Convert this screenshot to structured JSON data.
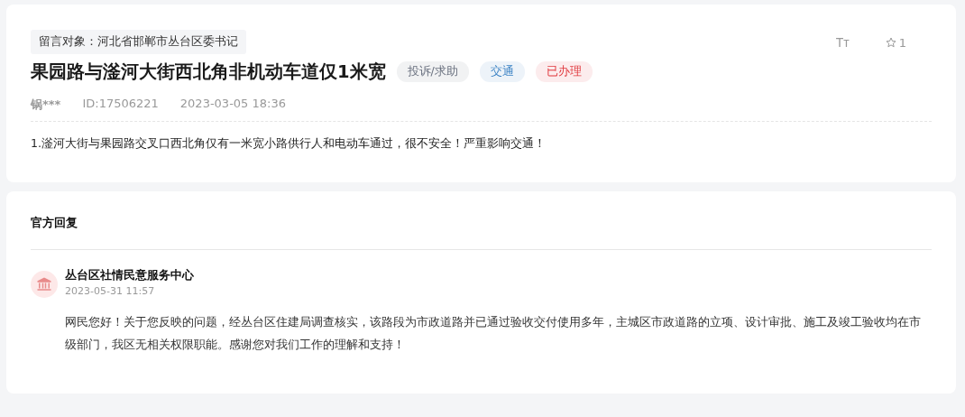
{
  "message": {
    "target": "留言对象：河北省邯郸市丛台区委书记",
    "title": "果园路与滏河大街西北角非机动车道仅1米宽",
    "tags": [
      {
        "label": "投诉/求助",
        "color": "#6b7280"
      },
      {
        "label": "交通",
        "color": "#3b82c4"
      },
      {
        "label": "已办理",
        "color": "#e0393e"
      }
    ],
    "text_size_label": "Tт",
    "star_count": "1",
    "author": "锅***",
    "id": "ID:17506221",
    "time": "2023-03-05 18:36",
    "body": "1.滏河大街与果园路交叉口西北角仅有一米宽小路供行人和电动车通过，很不安全！严重影响交通！"
  },
  "reply_section": {
    "heading": "官方回复",
    "replies": [
      {
        "org": "丛台区社情民意服务中心",
        "time": "2023-05-31 11:57",
        "body": "网民您好！关于您反映的问题，经丛台区住建局调查核实，该路段为市政道路并已通过验收交付使用多年，主城区市政道路的立项、设计审批、施工及竣工验收均在市级部门，我区无相关权限职能。感谢您对我们工作的理解和支持！"
      }
    ]
  }
}
